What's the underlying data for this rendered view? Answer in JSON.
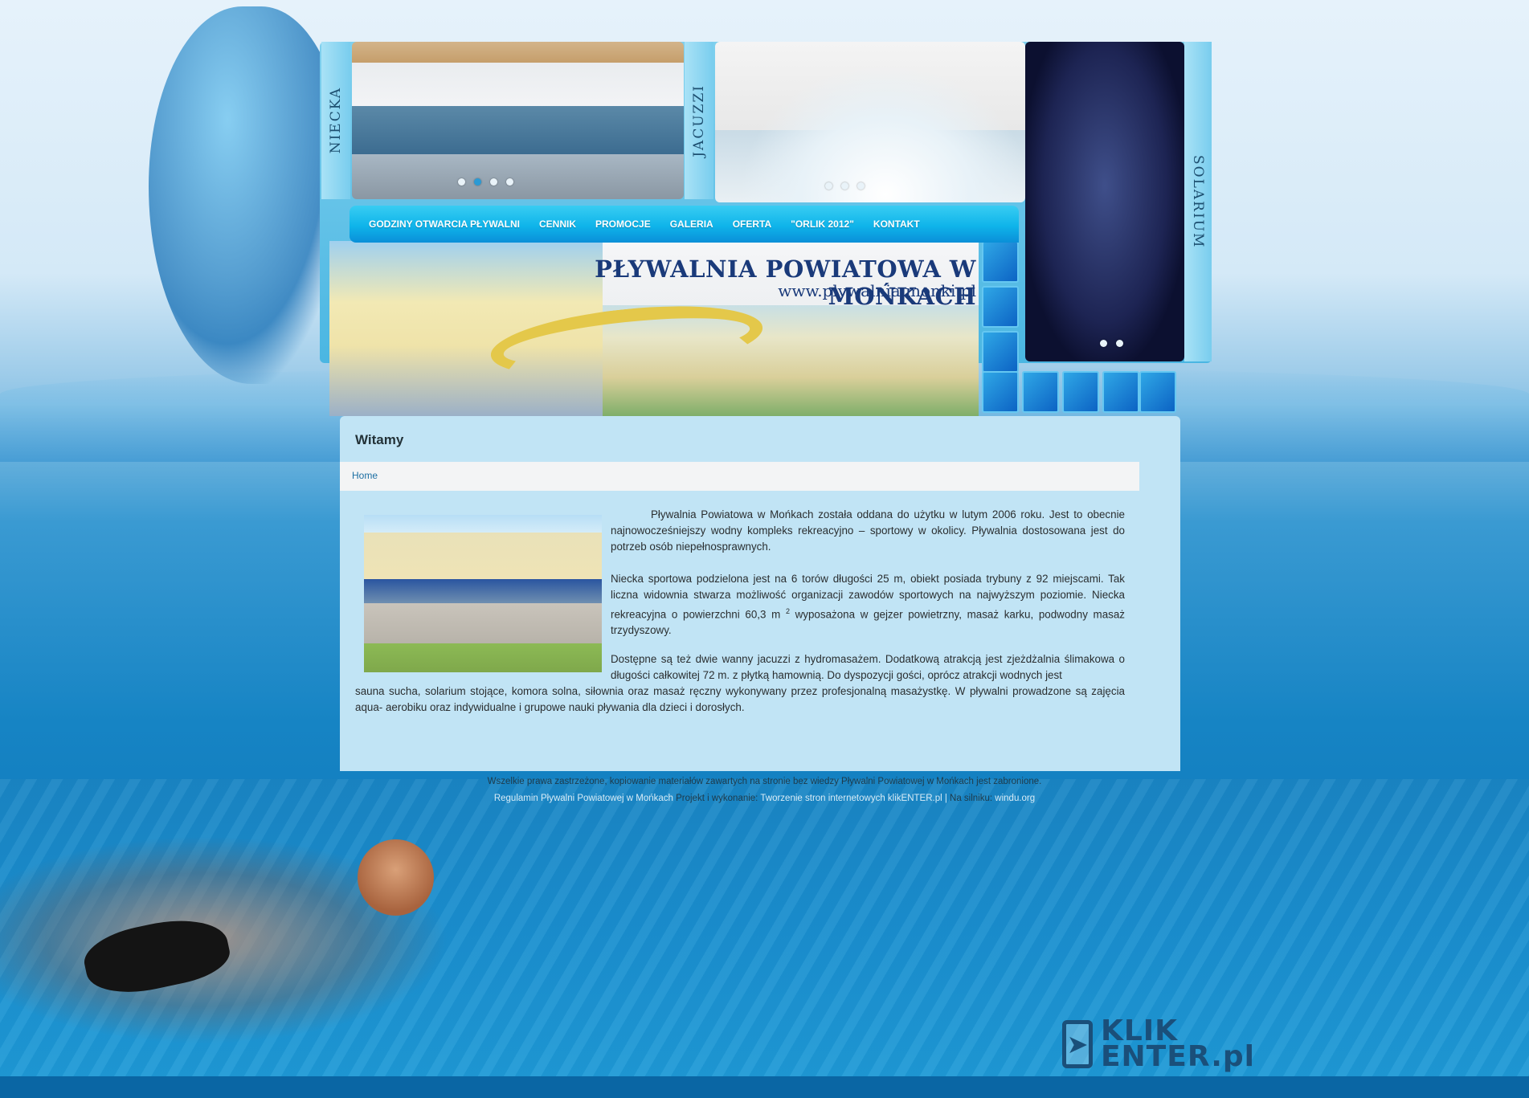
{
  "side_tabs": {
    "niecka": "NIECKA",
    "jacuzzi": "JACUZZI",
    "solarium": "SOLARIUM"
  },
  "slider_dots": {
    "pool": {
      "count": 4,
      "active_index": 1
    },
    "jacuzzi": {
      "count": 3,
      "active_index": -1
    },
    "solarium": {
      "count": 2,
      "active_index": -1
    }
  },
  "nav": {
    "items": [
      "GODZINY OTWARCIA PŁYWALNI",
      "CENNIK",
      "PROMOCJE",
      "GALERIA",
      "OFERTA",
      "\"ORLIK 2012\"",
      "KONTAKT"
    ]
  },
  "banner": {
    "title": "PŁYWALNIA POWIATOWA W MOŃKACH",
    "url": "www.plywalnia.monki.pl"
  },
  "content": {
    "title": "Witamy",
    "breadcrumb": "Home",
    "p1": "Pływalnia Powiatowa w Mońkach została oddana do użytku w lutym 2006 roku. Jest to obecnie najnowocześniejszy wodny kompleks rekreacyjno – sportowy w okolicy. Pływalnia dostosowana jest do potrzeb osób niepełnosprawnych.",
    "p2_before_sup": "Niecka sportowa podzielona jest na 6 torów długości 25 m, obiekt posiada trybuny z 92 miejscami. Tak liczna widownia stwarza możliwość organizacji zawodów sportowych na najwyższym poziomie. Niecka rekreacyjna o powierzchni 60,3 m",
    "p2_sup": "2",
    "p2_after_sup": " wyposażona w gejzer powietrzny, masaż karku, podwodny masaż trzydyszowy.",
    "p3_part1": "Dostępne są też dwie wanny jacuzzi z hydromasażem. Dodatkową atrakcją jest zjeżdżalnia ślimakowa o długości całkowitej 72 m. z płytką hamownią. Do dyspozycji gości, oprócz atrakcji wodnych jest",
    "p3_part2": "sauna sucha, solarium stojące, komora solna, siłownia oraz masaż ręczny wykonywany przez profesjonalną masażystkę. W pływalni prowadzone są zajęcia aqua- aerobiku oraz indywidualne i grupowe nauki pływania dla dzieci i dorosłych."
  },
  "footer": {
    "copyright": "Wszelkie prawa zastrzeżone, kopiowanie materiałów zawartych na stronie bez wiedzy Pływalni Powiatowej w Mońkach jest zabronione.",
    "regulamin_link": "Regulamin Pływalni Powiatowej w Mońkach",
    "projekt_label": "Projekt i wykonanie:",
    "projekt_link": "Tworzenie stron internetowych klikENTER.pl",
    "separator": " | ",
    "engine_label": "Na silniku:",
    "engine_link": "windu.org"
  },
  "logo": {
    "line1": "KLIK",
    "line2": "ENTER.pl"
  },
  "colors": {
    "nav_bg": "#0fb4ea",
    "content_bg": "#c1e4f5",
    "link": "#1d6fa3",
    "banner_text": "#1a3a7a"
  },
  "icons": {
    "cursor": "cursor-icon"
  }
}
